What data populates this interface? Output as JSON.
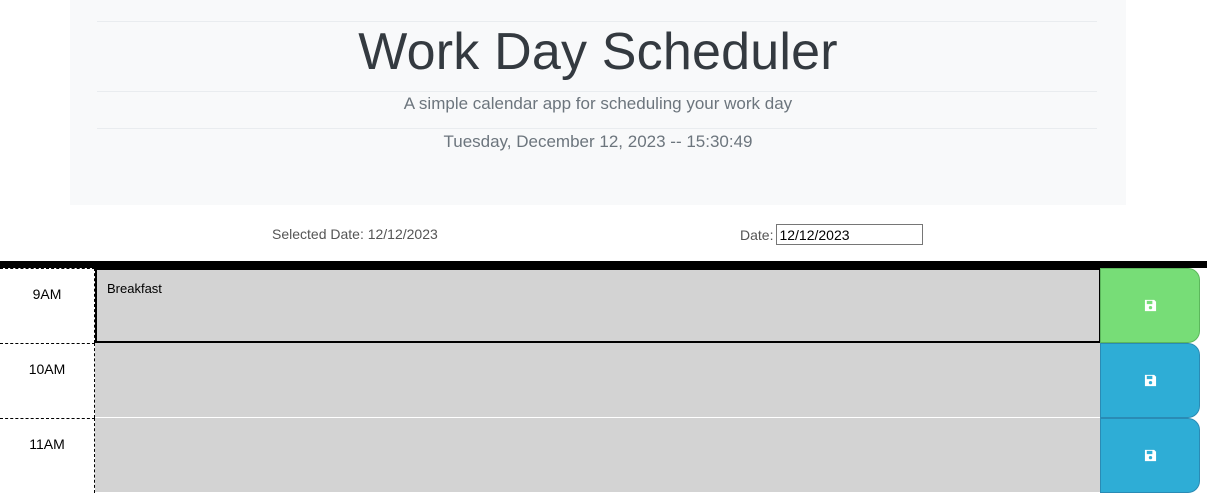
{
  "header": {
    "title": "Work Day Scheduler",
    "subtitle": "A simple calendar app for scheduling your work day",
    "current_datetime": "Tuesday, December 12, 2023 -- 15:30:49"
  },
  "selected_date": {
    "text": "Selected Date: 12/12/2023"
  },
  "date_picker": {
    "label": "Date:",
    "value": "12/12/2023"
  },
  "timeblocks": [
    {
      "hour": "9AM",
      "text": "Breakfast",
      "save_icon": "save-icon",
      "status_color": "#77dd77"
    },
    {
      "hour": "10AM",
      "text": "",
      "save_icon": "save-icon",
      "status_color": "#2eadd6"
    },
    {
      "hour": "11AM",
      "text": "",
      "save_icon": "save-icon",
      "status_color": "#2eadd6"
    }
  ],
  "colors": {
    "present": "#77dd77",
    "future": "#2eadd6",
    "textarea": "#d3d3d3",
    "jumbotron": "#f8f9fa"
  }
}
